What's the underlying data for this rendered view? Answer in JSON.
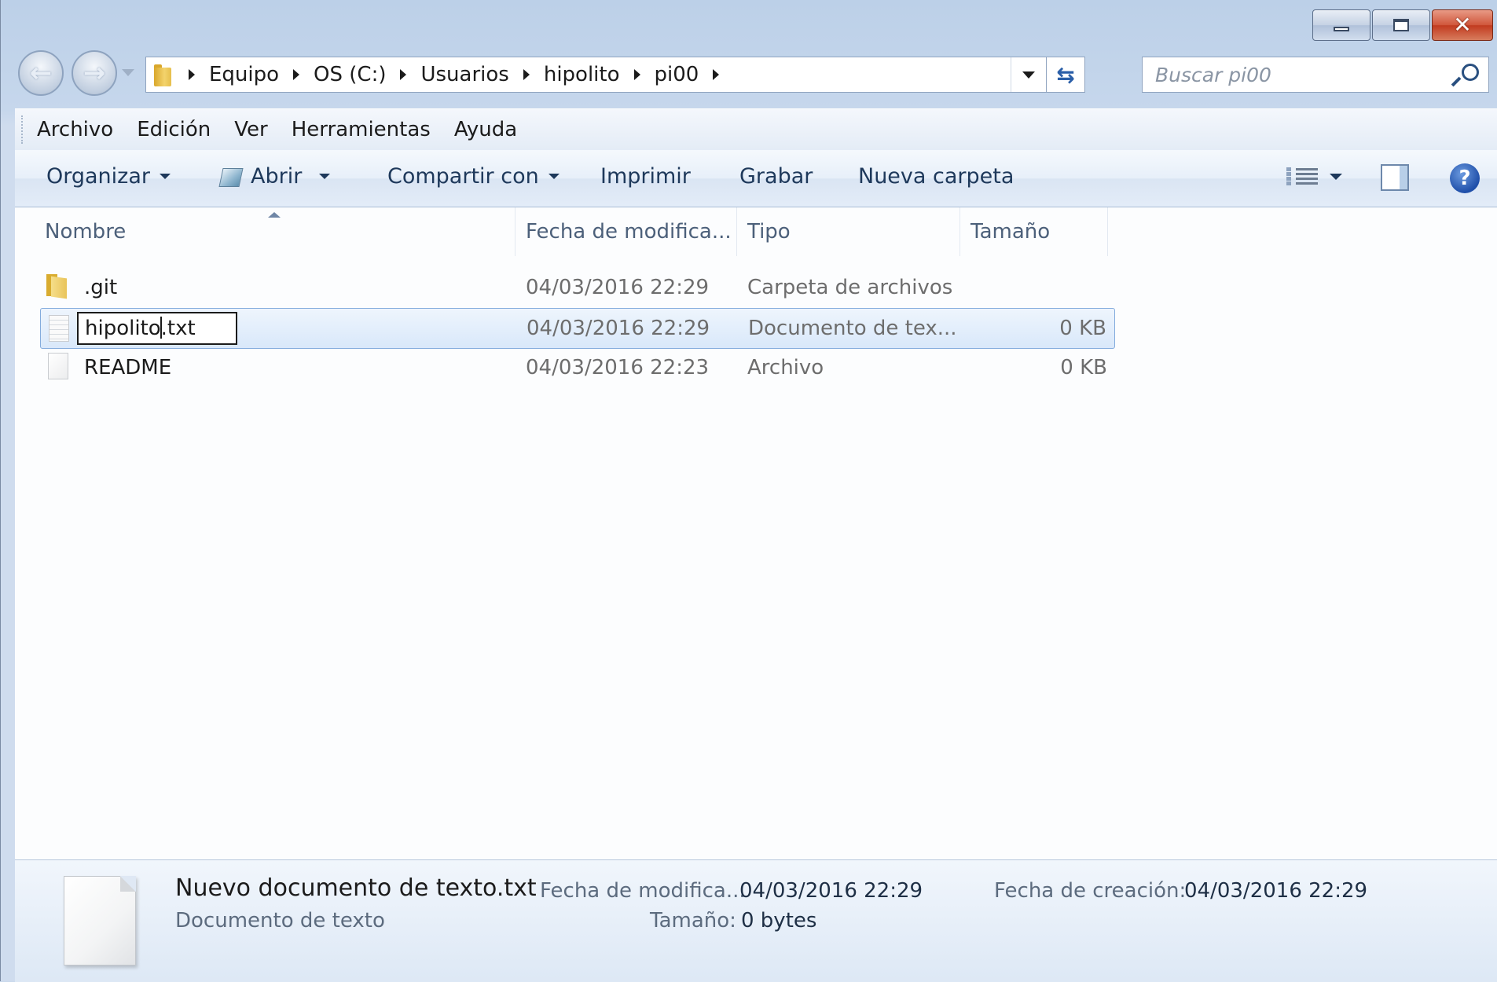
{
  "window": {
    "caption": {
      "minimize_icon": "minimize-icon",
      "maximize_icon": "restore-icon",
      "close_glyph": "✕"
    }
  },
  "nav": {
    "back_glyph": "←",
    "forward_glyph": "→"
  },
  "address": {
    "breadcrumbs": [
      "Equipo",
      "OS (C:)",
      "Usuarios",
      "hipolito",
      "pi00"
    ],
    "refresh_glyph": "⇆"
  },
  "search": {
    "placeholder": "Buscar pi00"
  },
  "menubar": {
    "items": [
      "Archivo",
      "Edición",
      "Ver",
      "Herramientas",
      "Ayuda"
    ]
  },
  "commandbar": {
    "organize": "Organizar",
    "open": "Abrir",
    "share": "Compartir con",
    "print": "Imprimir",
    "burn": "Grabar",
    "new_folder": "Nueva carpeta",
    "help_glyph": "?"
  },
  "columns": {
    "name": "Nombre",
    "modified": "Fecha de modifica...",
    "type": "Tipo",
    "size": "Tamaño"
  },
  "files": [
    {
      "name": ".git",
      "modified": "04/03/2016 22:29",
      "type": "Carpeta de archivos",
      "size": "",
      "icon": "folder-icon"
    },
    {
      "name": "hipolito.txt",
      "name_before_cursor": "hipolito",
      "name_after_cursor": ".txt",
      "modified": "04/03/2016 22:29",
      "type": "Documento de tex...",
      "size": "0 KB",
      "icon": "text-document-icon",
      "renaming": true
    },
    {
      "name": "README",
      "modified": "04/03/2016 22:23",
      "type": "Archivo",
      "size": "0 KB",
      "icon": "file-icon"
    }
  ],
  "details": {
    "name": "Nuevo documento de texto.txt",
    "type": "Documento de texto",
    "modified_label": "Fecha de modifica...",
    "modified_value": "04/03/2016 22:29",
    "created_label": "Fecha de creación:",
    "created_value": "04/03/2016 22:29",
    "size_label": "Tamaño:",
    "size_value": "0 bytes"
  },
  "colors": {
    "selection_border": "#84acdd",
    "selection_fill": "#d9e8fa",
    "frame": "#c6d7ec"
  }
}
